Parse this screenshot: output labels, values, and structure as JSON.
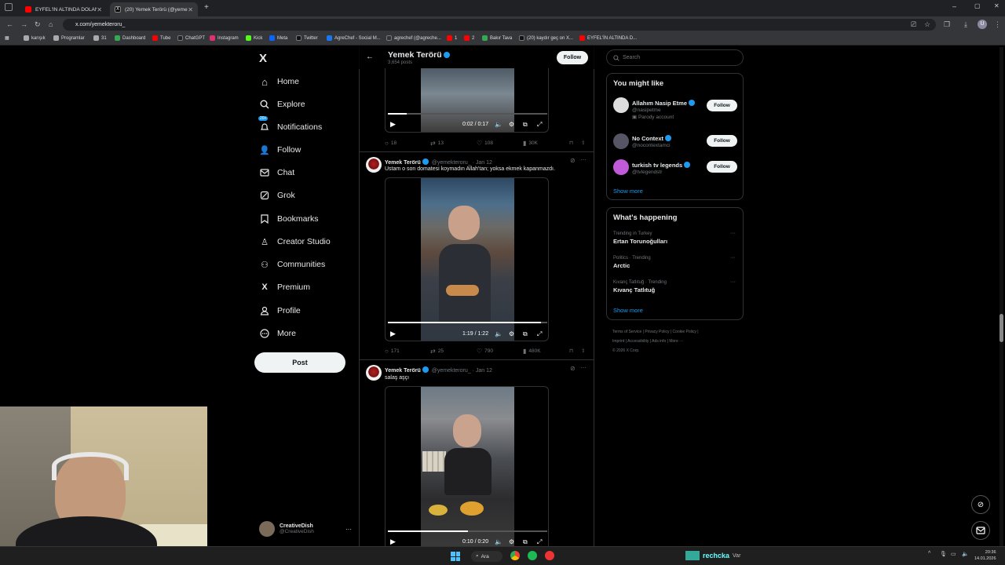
{
  "browser": {
    "tabs": [
      {
        "title": "EYFEL'İN ALTINDA DOLANDIRI",
        "active": false
      },
      {
        "title": "(20) Yemek Terörü (@yemekt",
        "active": true
      }
    ],
    "url": "x.com/yemekteroru_",
    "bookmarks": [
      "karışık",
      "Programlar",
      "31",
      "Dashboard",
      "Tube",
      "ChatGPT",
      "Instagram",
      "Kick",
      "Meta",
      "Twitter",
      "AgreChef - Social M...",
      "agrechef (@agreche...",
      "1",
      "2",
      "Bakır Tava",
      "(20) kaydır geç on X...",
      "EYFEL'İN ALTINDA D..."
    ],
    "profile_initial": "U"
  },
  "nav": {
    "logo": "X",
    "items": [
      {
        "label": "Home",
        "icon": "home-icon"
      },
      {
        "label": "Explore",
        "icon": "search-icon"
      },
      {
        "label": "Notifications",
        "icon": "bell-icon",
        "badge": "20+"
      },
      {
        "label": "Follow",
        "icon": "person-add-icon"
      },
      {
        "label": "Chat",
        "icon": "mail-icon"
      },
      {
        "label": "Grok",
        "icon": "grok-icon"
      },
      {
        "label": "Bookmarks",
        "icon": "bookmark-icon"
      },
      {
        "label": "Creator Studio",
        "icon": "creator-studio-icon"
      },
      {
        "label": "Communities",
        "icon": "communities-icon"
      },
      {
        "label": "Premium",
        "icon": "x-premium-icon"
      },
      {
        "label": "Profile",
        "icon": "profile-icon"
      },
      {
        "label": "More",
        "icon": "more-circle-icon"
      }
    ],
    "post_label": "Post",
    "account": {
      "name": "CreativeDish",
      "handle": "@CreativeDish"
    }
  },
  "header": {
    "name": "Yemek Terörü",
    "posts": "3,654 posts",
    "follow": "Follow"
  },
  "tweets": [
    {
      "video_time": "0:02 / 0:17",
      "progress": 0.12,
      "replies": "18",
      "reposts": "13",
      "likes": "108",
      "views": "30K"
    },
    {
      "name": "Yemek Terörü",
      "handle": "@yemekteroru_",
      "date": "· Jan 12",
      "text": "Ustam o son domatesi koymadın Allah'tan; yoksa ekmek kapanmazdı.",
      "video_time": "1:19 / 1:22",
      "progress": 0.96,
      "replies": "171",
      "reposts": "25",
      "likes": "790",
      "views": "480K"
    },
    {
      "name": "Yemek Terörü",
      "handle": "@yemekteroru_",
      "date": "· Jan 12",
      "text": "salaş aşçı",
      "video_time": "0:10 / 0:20",
      "progress": 0.5
    }
  ],
  "right": {
    "search_placeholder": "Search",
    "you_might_like": "You might like",
    "suggestions": [
      {
        "name": "Allahım Nasip Etme",
        "handle": "@nasipetme",
        "note": "Parody account",
        "follow": "Follow"
      },
      {
        "name": "No Context",
        "handle": "@nocontextamci",
        "follow": "Follow"
      },
      {
        "name": "turkish tv legends",
        "handle": "@tvlegendstr",
        "follow": "Follow"
      }
    ],
    "show_more": "Show more",
    "whats_happening": "What's happening",
    "trends": [
      {
        "context": "Trending in Turkey",
        "name": "Ertan Torunoğulları"
      },
      {
        "context": "Politics · Trending",
        "name": "Arctic"
      },
      {
        "context": "Kıvanç Tatlıtuğ · Trending",
        "name": "Kıvanç Tatlıtuğ"
      }
    ],
    "show_more2": "Show more",
    "footer": [
      "Terms of Service",
      "|",
      "Privacy Policy",
      "|",
      "Cookie Policy",
      "|",
      "Imprint",
      "|",
      "Accessibility",
      "|",
      "Ads info",
      "|",
      "More ···"
    ],
    "copyright": "© 2026 X Corp."
  },
  "taskbar": {
    "search": "Ara",
    "time": "20:36",
    "date": "14.01.2026",
    "stream_label": "rechcka",
    "stream_sub": "Var"
  }
}
